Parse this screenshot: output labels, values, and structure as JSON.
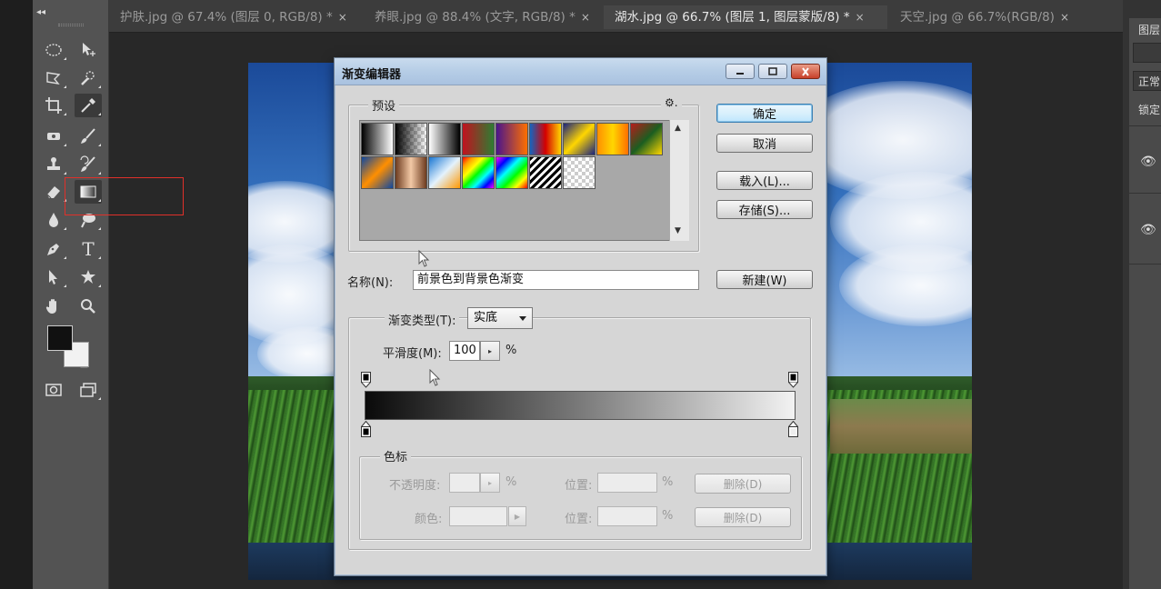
{
  "tabs": [
    {
      "label": "护肤.jpg @ 67.4% (图层 0, RGB/8) *",
      "close": "×",
      "active": false
    },
    {
      "label": "养眼.jpg @ 88.4% (文字, RGB/8) *",
      "close": "×",
      "active": false
    },
    {
      "label": "湖水.jpg @ 66.7% (图层 1, 图层蒙版/8) *",
      "close": "×",
      "active": true
    },
    {
      "label": "天空.jpg @ 66.7%(RGB/8)",
      "close": "×",
      "active": false
    }
  ],
  "toolbar": {
    "collapse": "◂◂",
    "swap": "↰",
    "foreground_color": "#111111",
    "background_color": "#f2f2f2",
    "highlight_color": "#e0302a",
    "type_tool_glyph": "T"
  },
  "right_panel": {
    "title": "图层",
    "mode_label": "正常",
    "lock_label": "锁定",
    "eye_glyph": "👁"
  },
  "dialog": {
    "title": "渐变编辑器",
    "presets_legend": "预设",
    "gear": "⚙.",
    "buttons": {
      "ok": "确定",
      "cancel": "取消",
      "load": "载入(L)...",
      "save": "存储(S)...",
      "new": "新建(W)"
    },
    "name_label": "名称(N):",
    "name_value": "前景色到背景色渐变",
    "gradient_type_label": "渐变类型(T):",
    "gradient_type_value": "实底",
    "smoothness_label": "平滑度(M):",
    "smoothness_value": "100",
    "smoothness_unit": "%",
    "stops_legend": "色标",
    "opacity_label": "不透明度:",
    "opacity_unit": "%",
    "position_label": "位置:",
    "position_unit": "%",
    "delete_label": "删除(D)",
    "color_label": "颜色:",
    "position2_label": "位置:",
    "position2_unit": "%",
    "delete2_label": "删除(D)",
    "gradient_start": "#0a0a0a",
    "gradient_end": "#f2f2f2"
  }
}
